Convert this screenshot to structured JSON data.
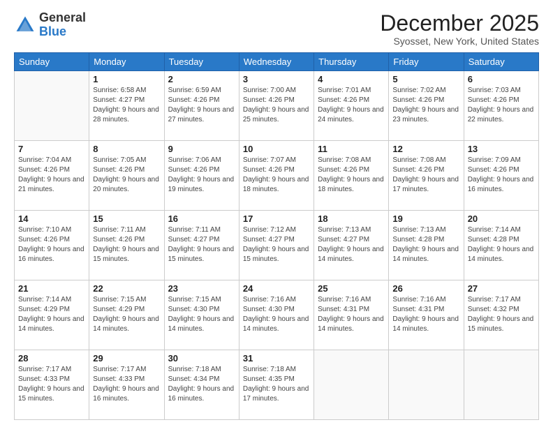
{
  "header": {
    "logo_general": "General",
    "logo_blue": "Blue",
    "month_title": "December 2025",
    "location": "Syosset, New York, United States"
  },
  "weekdays": [
    "Sunday",
    "Monday",
    "Tuesday",
    "Wednesday",
    "Thursday",
    "Friday",
    "Saturday"
  ],
  "weeks": [
    [
      {
        "day": "",
        "sunrise": "",
        "sunset": "",
        "daylight": ""
      },
      {
        "day": "1",
        "sunrise": "Sunrise: 6:58 AM",
        "sunset": "Sunset: 4:27 PM",
        "daylight": "Daylight: 9 hours and 28 minutes."
      },
      {
        "day": "2",
        "sunrise": "Sunrise: 6:59 AM",
        "sunset": "Sunset: 4:26 PM",
        "daylight": "Daylight: 9 hours and 27 minutes."
      },
      {
        "day": "3",
        "sunrise": "Sunrise: 7:00 AM",
        "sunset": "Sunset: 4:26 PM",
        "daylight": "Daylight: 9 hours and 25 minutes."
      },
      {
        "day": "4",
        "sunrise": "Sunrise: 7:01 AM",
        "sunset": "Sunset: 4:26 PM",
        "daylight": "Daylight: 9 hours and 24 minutes."
      },
      {
        "day": "5",
        "sunrise": "Sunrise: 7:02 AM",
        "sunset": "Sunset: 4:26 PM",
        "daylight": "Daylight: 9 hours and 23 minutes."
      },
      {
        "day": "6",
        "sunrise": "Sunrise: 7:03 AM",
        "sunset": "Sunset: 4:26 PM",
        "daylight": "Daylight: 9 hours and 22 minutes."
      }
    ],
    [
      {
        "day": "7",
        "sunrise": "Sunrise: 7:04 AM",
        "sunset": "Sunset: 4:26 PM",
        "daylight": "Daylight: 9 hours and 21 minutes."
      },
      {
        "day": "8",
        "sunrise": "Sunrise: 7:05 AM",
        "sunset": "Sunset: 4:26 PM",
        "daylight": "Daylight: 9 hours and 20 minutes."
      },
      {
        "day": "9",
        "sunrise": "Sunrise: 7:06 AM",
        "sunset": "Sunset: 4:26 PM",
        "daylight": "Daylight: 9 hours and 19 minutes."
      },
      {
        "day": "10",
        "sunrise": "Sunrise: 7:07 AM",
        "sunset": "Sunset: 4:26 PM",
        "daylight": "Daylight: 9 hours and 18 minutes."
      },
      {
        "day": "11",
        "sunrise": "Sunrise: 7:08 AM",
        "sunset": "Sunset: 4:26 PM",
        "daylight": "Daylight: 9 hours and 18 minutes."
      },
      {
        "day": "12",
        "sunrise": "Sunrise: 7:08 AM",
        "sunset": "Sunset: 4:26 PM",
        "daylight": "Daylight: 9 hours and 17 minutes."
      },
      {
        "day": "13",
        "sunrise": "Sunrise: 7:09 AM",
        "sunset": "Sunset: 4:26 PM",
        "daylight": "Daylight: 9 hours and 16 minutes."
      }
    ],
    [
      {
        "day": "14",
        "sunrise": "Sunrise: 7:10 AM",
        "sunset": "Sunset: 4:26 PM",
        "daylight": "Daylight: 9 hours and 16 minutes."
      },
      {
        "day": "15",
        "sunrise": "Sunrise: 7:11 AM",
        "sunset": "Sunset: 4:26 PM",
        "daylight": "Daylight: 9 hours and 15 minutes."
      },
      {
        "day": "16",
        "sunrise": "Sunrise: 7:11 AM",
        "sunset": "Sunset: 4:27 PM",
        "daylight": "Daylight: 9 hours and 15 minutes."
      },
      {
        "day": "17",
        "sunrise": "Sunrise: 7:12 AM",
        "sunset": "Sunset: 4:27 PM",
        "daylight": "Daylight: 9 hours and 15 minutes."
      },
      {
        "day": "18",
        "sunrise": "Sunrise: 7:13 AM",
        "sunset": "Sunset: 4:27 PM",
        "daylight": "Daylight: 9 hours and 14 minutes."
      },
      {
        "day": "19",
        "sunrise": "Sunrise: 7:13 AM",
        "sunset": "Sunset: 4:28 PM",
        "daylight": "Daylight: 9 hours and 14 minutes."
      },
      {
        "day": "20",
        "sunrise": "Sunrise: 7:14 AM",
        "sunset": "Sunset: 4:28 PM",
        "daylight": "Daylight: 9 hours and 14 minutes."
      }
    ],
    [
      {
        "day": "21",
        "sunrise": "Sunrise: 7:14 AM",
        "sunset": "Sunset: 4:29 PM",
        "daylight": "Daylight: 9 hours and 14 minutes."
      },
      {
        "day": "22",
        "sunrise": "Sunrise: 7:15 AM",
        "sunset": "Sunset: 4:29 PM",
        "daylight": "Daylight: 9 hours and 14 minutes."
      },
      {
        "day": "23",
        "sunrise": "Sunrise: 7:15 AM",
        "sunset": "Sunset: 4:30 PM",
        "daylight": "Daylight: 9 hours and 14 minutes."
      },
      {
        "day": "24",
        "sunrise": "Sunrise: 7:16 AM",
        "sunset": "Sunset: 4:30 PM",
        "daylight": "Daylight: 9 hours and 14 minutes."
      },
      {
        "day": "25",
        "sunrise": "Sunrise: 7:16 AM",
        "sunset": "Sunset: 4:31 PM",
        "daylight": "Daylight: 9 hours and 14 minutes."
      },
      {
        "day": "26",
        "sunrise": "Sunrise: 7:16 AM",
        "sunset": "Sunset: 4:31 PM",
        "daylight": "Daylight: 9 hours and 14 minutes."
      },
      {
        "day": "27",
        "sunrise": "Sunrise: 7:17 AM",
        "sunset": "Sunset: 4:32 PM",
        "daylight": "Daylight: 9 hours and 15 minutes."
      }
    ],
    [
      {
        "day": "28",
        "sunrise": "Sunrise: 7:17 AM",
        "sunset": "Sunset: 4:33 PM",
        "daylight": "Daylight: 9 hours and 15 minutes."
      },
      {
        "day": "29",
        "sunrise": "Sunrise: 7:17 AM",
        "sunset": "Sunset: 4:33 PM",
        "daylight": "Daylight: 9 hours and 16 minutes."
      },
      {
        "day": "30",
        "sunrise": "Sunrise: 7:18 AM",
        "sunset": "Sunset: 4:34 PM",
        "daylight": "Daylight: 9 hours and 16 minutes."
      },
      {
        "day": "31",
        "sunrise": "Sunrise: 7:18 AM",
        "sunset": "Sunset: 4:35 PM",
        "daylight": "Daylight: 9 hours and 17 minutes."
      },
      {
        "day": "",
        "sunrise": "",
        "sunset": "",
        "daylight": ""
      },
      {
        "day": "",
        "sunrise": "",
        "sunset": "",
        "daylight": ""
      },
      {
        "day": "",
        "sunrise": "",
        "sunset": "",
        "daylight": ""
      }
    ]
  ]
}
